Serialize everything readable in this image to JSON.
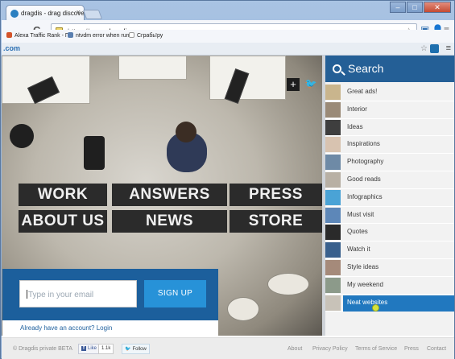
{
  "browser": {
    "tab_title": "dragdis - drag discoveries",
    "tab_close": "×",
    "window_buttons": {
      "minimize": "–",
      "maximize": "□",
      "close": "✕"
    },
    "nav": {
      "back": "←",
      "forward": "→",
      "reload": "C"
    },
    "url_protocol": "https://",
    "url_host": "www.dragdis.com",
    "bookmarks": [
      {
        "label": "Alexa Traffic Rank - Г...",
        "color": "#d4542a"
      },
      {
        "label": "ntvdm error when run...",
        "color": "#5a7fb0"
      },
      {
        "label": "Сграбь!ру",
        "color": "#ffffff"
      }
    ]
  },
  "pagebar": {
    "brand": ".com"
  },
  "hero": {
    "words": [
      "WORK",
      "ANSWERS",
      "PRESS",
      "ABOUT US",
      "NEWS",
      "STORE"
    ]
  },
  "signup": {
    "email_placeholder": "Type in your email",
    "button": "SIGN UP",
    "login_link": "Already have an account? Login"
  },
  "sidebar": {
    "search_label": "Search",
    "categories": [
      {
        "label": "Great ads!",
        "thumb": "#c9b58d"
      },
      {
        "label": "Interior",
        "thumb": "#9a8a77"
      },
      {
        "label": "Ideas",
        "thumb": "#3e3e3e"
      },
      {
        "label": "Inspirations",
        "thumb": "#d8c3b0"
      },
      {
        "label": "Photography",
        "thumb": "#6e8aa6"
      },
      {
        "label": "Good reads",
        "thumb": "#b8b0a4"
      },
      {
        "label": "Infographics",
        "thumb": "#4aa3d6"
      },
      {
        "label": "Must visit",
        "thumb": "#5d87b8"
      },
      {
        "label": "Quotes",
        "thumb": "#2a2a2a"
      },
      {
        "label": "Watch it",
        "thumb": "#39608d"
      },
      {
        "label": "Style ideas",
        "thumb": "#a58a7a"
      },
      {
        "label": "My weekend",
        "thumb": "#8c9a8a"
      },
      {
        "label": "Neat websites",
        "thumb": "#c8c2b8"
      }
    ],
    "active_index": 12
  },
  "footer": {
    "copyright": "© Dragdis private BETA",
    "fb_like": "Like",
    "fb_count": "1.1k",
    "tw_follow": "Follow",
    "links": [
      "About",
      "Privacy Policy",
      "Terms of Service",
      "Press",
      "Contact"
    ]
  }
}
